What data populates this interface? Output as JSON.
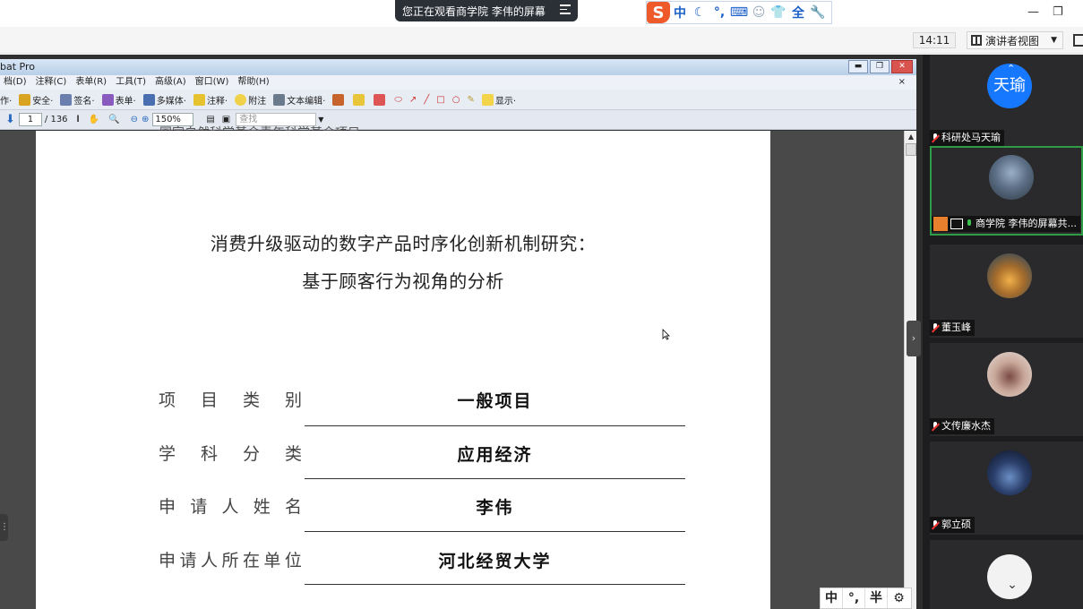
{
  "meeting": {
    "share_banner": "您正在观看商学院 李伟的屏幕",
    "clock": "14:11",
    "view_mode": "演讲者视图"
  },
  "ime": {
    "logo": "S",
    "mode": "中",
    "punct": "°,",
    "small_bar": [
      "中",
      "°,",
      "半"
    ]
  },
  "acrobat": {
    "title": "bat Pro",
    "menu": [
      "档(D)",
      "注释(C)",
      "表单(R)",
      "工具(T)",
      "高级(A)",
      "窗口(W)",
      "帮助(H)"
    ],
    "tools": [
      "作·",
      "安全·",
      "签名·",
      "表单·",
      "多媒体·",
      "注释·",
      "附注",
      "文本编辑·",
      "显示·"
    ],
    "page_current": "1",
    "page_total": "/ 136",
    "zoom": "150%",
    "search_placeholder": "查找"
  },
  "document": {
    "cut_header": "国家自然科学基金青年科学基金项目",
    "title_line1": "消费升级驱动的数字产品时序化创新机制研究：",
    "title_line2": "基于顾客行为视角的分析",
    "fields": [
      {
        "label": "项目类别",
        "value": "一般项目"
      },
      {
        "label": "学科分类",
        "value": "应用经济"
      },
      {
        "label": "申请人姓名",
        "value": "李伟"
      },
      {
        "label": "申请人所在单位",
        "value": "河北经贸大学"
      }
    ]
  },
  "participants": [
    {
      "name": "科研处马天瑜",
      "avatar_text": "天瑜",
      "mic": "muted"
    },
    {
      "name": "商学院 李伟的屏幕共...",
      "mic": "on",
      "sharing": true
    },
    {
      "name": "董玉峰",
      "mic": "muted"
    },
    {
      "name": "文传廉水杰",
      "mic": "muted"
    },
    {
      "name": "郭立硕",
      "mic": "muted"
    },
    {
      "name": "",
      "mic": "none"
    }
  ],
  "colors": {
    "accent": "#1677ff",
    "active_border": "#2f9d45",
    "ime_logo": "#ef5a2a"
  }
}
